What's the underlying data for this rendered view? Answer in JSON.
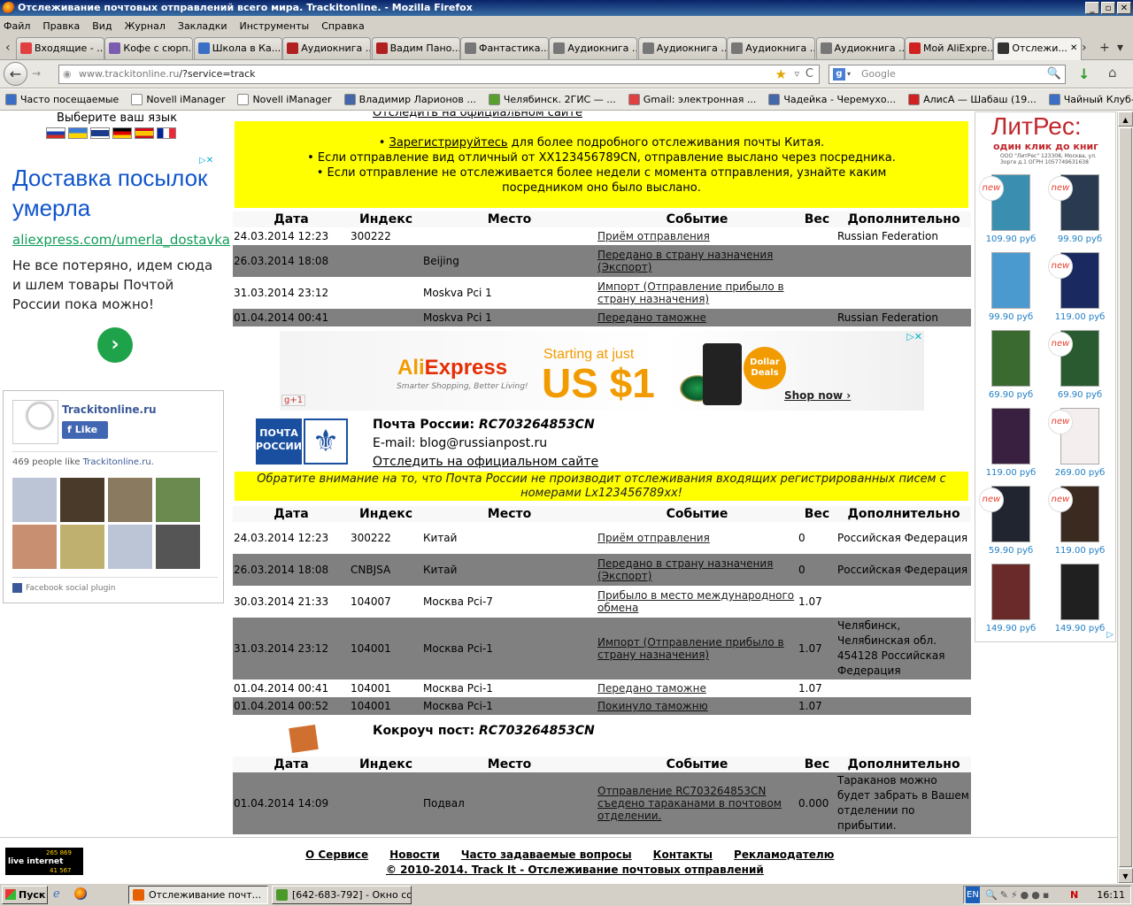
{
  "window": {
    "title": "Отслеживание почтовых отправлений всего мира. Trackitonline. - Mozilla Firefox",
    "controls": [
      "_",
      "▫",
      "✕"
    ]
  },
  "menu": [
    "Файл",
    "Правка",
    "Вид",
    "Журнал",
    "Закладки",
    "Инструменты",
    "Справка"
  ],
  "tabs": [
    {
      "label": "Входящие - ...",
      "color": "#e04040"
    },
    {
      "label": "Кофе с сюрп...",
      "color": "#7a5cb0"
    },
    {
      "label": "Школа в Ка...",
      "color": "#3b6fc6"
    },
    {
      "label": "Аудиокнига ...",
      "color": "#b02020"
    },
    {
      "label": "Вадим Пано...",
      "color": "#b02020"
    },
    {
      "label": "Фантастика...",
      "color": "#777777"
    },
    {
      "label": "Аудиокнига ...",
      "color": "#777777"
    },
    {
      "label": "Аудиокнига ...",
      "color": "#777777"
    },
    {
      "label": "Аудиокнига ...",
      "color": "#777777"
    },
    {
      "label": "Аудиокнига ...",
      "color": "#777777"
    },
    {
      "label": "Мой AliExpre...",
      "color": "#d02020"
    },
    {
      "label": "Отслежи...",
      "color": "#333333",
      "active": true
    }
  ],
  "tab_close": "✕",
  "tab_new": "+",
  "tab_list": "▾",
  "nav": {
    "back": "←",
    "url_host": "www.trackitonline.ru",
    "url_path": "/?service=track",
    "search_placeholder": "Google",
    "search_engine_letter": "g",
    "star": "★",
    "reload": "C",
    "search_icon": "🔍",
    "download": "↓",
    "home": "⌂"
  },
  "bookmarks": [
    {
      "label": "Часто посещаемые",
      "color": "#3b6fc6"
    },
    {
      "label": "Novell iManager",
      "color": "#ffffff"
    },
    {
      "label": "Novell iManager",
      "color": "#ffffff"
    },
    {
      "label": "Владимир Ларионов ...",
      "color": "#4466aa"
    },
    {
      "label": "Челябинск. 2ГИС — ...",
      "color": "#58a02c"
    },
    {
      "label": "Gmail: электронная ...",
      "color": "#e04040"
    },
    {
      "label": "Чадейка - Черемухо...",
      "color": "#4466aa"
    },
    {
      "label": "АлисА — Шабаш (19...",
      "color": "#d02020"
    },
    {
      "label": "Чайный Клуб-Магаз...",
      "color": "#3b6fc6"
    }
  ],
  "lang": {
    "label": "Выберите ваш язык",
    "flags": [
      "ru",
      "ua",
      "gb",
      "de",
      "es",
      "fr"
    ]
  },
  "ad_left": {
    "headline": "Доставка посылок умерла",
    "url": "aliexpress.com/umerla_dostavka",
    "text": "Не все потеряно, идем сюда и шлем товары Почтой России пока можно!",
    "go": "›",
    "choices": "▷✕"
  },
  "facebook": {
    "page_name": "Trackitonline.ru",
    "like": "Like",
    "count_text": "469 people like",
    "count_link": "Trackitonline.ru",
    "count_end": ".",
    "plugin": "Facebook social plugin",
    "faces": [
      "#bcc5d6",
      "#4a3a2a",
      "#8a7a60",
      "#6a8a50",
      "#c89070",
      "#c0b070",
      "#bcc5d6",
      "#555555"
    ]
  },
  "top_link": "Отследить на официальном сайте",
  "china_note": {
    "link": "Зарегистрируйтесь",
    "l1_rest": " для более подробного отслеживания почты Китая.",
    "l2": "• Если отправление вид отличный от XX123456789CN, отправление выслано через посредника.",
    "l3": "• Если отправление не отслеживается более недели с момента отправления, узнайте каким посредником оно было выслано."
  },
  "headers": [
    "Дата",
    "Индекс",
    "Место",
    "Событие",
    "Вес",
    "Дополнительно"
  ],
  "table1": [
    {
      "date": "24.03.2014 12:23",
      "idx": "300222",
      "place": "",
      "event": "Приём отправления",
      "w": "",
      "add": "Russian Federation"
    },
    {
      "date": "26.03.2014 18:08",
      "idx": "",
      "place": "Beijing",
      "event": "Передано в страну назначения (Экспорт)",
      "w": "",
      "add": ""
    },
    {
      "date": "31.03.2014 23:12",
      "idx": "",
      "place": "Moskva Pci 1",
      "event": "Импорт (Отправление прибыло в страну назначения)",
      "w": "",
      "add": ""
    },
    {
      "date": "01.04.2014 00:41",
      "idx": "",
      "place": "Moskva Pci 1",
      "event": "Передано таможне",
      "w": "",
      "add": "Russian Federation"
    }
  ],
  "ali_ad": {
    "brand": "Ali",
    "brand2": "xpress",
    "tagline": "Smarter Shopping, Better Living!",
    "starting": "Starting at just",
    "price": "US $1",
    "deal1": "Dollar",
    "deal2": "Deals",
    "shop": "Shop now ›",
    "gplus": "g+1",
    "close": "▷✕"
  },
  "russianpost": {
    "logo_text": [
      "ПОЧТА",
      "РОССИИ"
    ],
    "emblem": "⚜",
    "title": "Почта России:",
    "track": "RC703264853CN",
    "email": "E-mail: blog@russianpost.ru",
    "link": "Отследить на официальном сайте",
    "note": "Обратите внимание на то, что Почта России не производит отслеживания входящих регистрированных писем с номерами Lx123456789xx!"
  },
  "table2": [
    {
      "date": "24.03.2014 12:23",
      "idx": "300222",
      "place": "Китай",
      "event": "Приём отправления",
      "w": "0",
      "add": "Российская Федерация"
    },
    {
      "date": "26.03.2014 18:08",
      "idx": "CNBJSA",
      "place": "Китай",
      "event": "Передано в страну назначения (Экспорт)",
      "w": "0",
      "add": "Российская Федерация"
    },
    {
      "date": "30.03.2014 21:33",
      "idx": "104007",
      "place": "Москва Pci-7",
      "event": "Прибыло в место международного обмена",
      "w": "1.07",
      "add": ""
    },
    {
      "date": "31.03.2014 23:12",
      "idx": "104001",
      "place": "Москва Pci-1",
      "event": "Импорт (Отправление прибыло в страну назначения)",
      "w": "1.07",
      "add": "Челябинск, Челябинская обл. 454128 Российская Федерация"
    },
    {
      "date": "01.04.2014 00:41",
      "idx": "104001",
      "place": "Москва Pci-1",
      "event": "Передано таможне",
      "w": "1.07",
      "add": ""
    },
    {
      "date": "01.04.2014 00:52",
      "idx": "104001",
      "place": "Москва Pci-1",
      "event": "Покинуло таможню",
      "w": "1.07",
      "add": ""
    }
  ],
  "kokroach": {
    "title": "Кокроуч пост:",
    "track": "RC703264853CN"
  },
  "table3": [
    {
      "date": "01.04.2014 14:09",
      "idx": "",
      "place": "Подвал",
      "event": "Отправление RC703264853CN съедено тараканами в почтовом отделении.",
      "w": "0.000",
      "add": "Тараканов можно будет забрать в Вашем отделении по прибытии."
    }
  ],
  "litres": {
    "brand": "ЛитРес:",
    "slogan": "один клик до книг",
    "legal": "ООО \"ЛитРес\" 123308, Москва, ул. Зорге д.1 ОГРН 1057749631638",
    "new": "new",
    "books": [
      {
        "price": "109.90 руб",
        "color": "#3a8fb0",
        "new": true
      },
      {
        "price": "99.90 руб",
        "color": "#2a3a50",
        "new": true
      },
      {
        "price": "99.90 руб",
        "color": "#4a9ad0",
        "new": false
      },
      {
        "price": "119.00 руб",
        "color": "#1a2a60",
        "new": true
      },
      {
        "price": "69.90 руб",
        "color": "#3a6a30",
        "new": false
      },
      {
        "price": "69.90 руб",
        "color": "#2a5a30",
        "new": true
      },
      {
        "price": "119.00 руб",
        "color": "#3a2040",
        "new": false
      },
      {
        "price": "269.00 руб",
        "color": "#f4eeee",
        "new": true
      },
      {
        "price": "59.90 руб",
        "color": "#202530",
        "new": true
      },
      {
        "price": "119.00 руб",
        "color": "#3a2a20",
        "new": true
      },
      {
        "price": "149.90 руб",
        "color": "#6a2a2a",
        "new": false
      },
      {
        "price": "149.90 руб",
        "color": "#202020",
        "new": false
      }
    ]
  },
  "footer": {
    "links": [
      "О Сервисе",
      "Новости",
      "Часто задаваемые вопросы",
      "Контакты",
      "Рекламодателю"
    ],
    "copyright": "© 2010-2014. Track It - Отслеживание почтовых отправлений",
    "counter": {
      "top": "265 869",
      "mid": "live internet",
      "bot": "41 567"
    }
  },
  "taskbar": {
    "start": "Пуск",
    "items": [
      {
        "label": "Отслеживание почт...",
        "active": true,
        "color": "#e66000"
      },
      {
        "label": "[642-683-792] - Окно со...",
        "active": false,
        "color": "#4a9a2a"
      }
    ],
    "lang": "EN",
    "time": "16:11"
  }
}
